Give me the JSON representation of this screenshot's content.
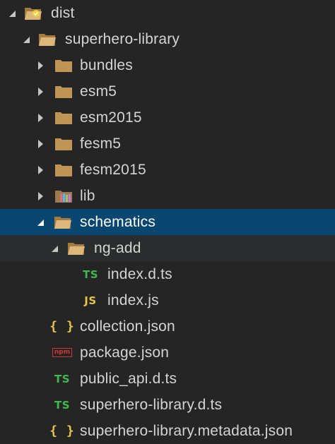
{
  "explorer": {
    "colors": {
      "background": "#252526",
      "selection": "#094771",
      "hover": "#2a2d2e",
      "folder": "#c09553",
      "ts": "#3fb950",
      "js": "#e8c547",
      "npm": "#cb3837"
    },
    "items": [
      {
        "label": "dist",
        "kind": "folder-open",
        "icon": "folder-open-icon",
        "expanded": true
      },
      {
        "label": "superhero-library",
        "kind": "folder-open",
        "icon": "folder-open-icon",
        "expanded": true
      },
      {
        "label": "bundles",
        "kind": "folder",
        "icon": "folder-icon",
        "expanded": false
      },
      {
        "label": "esm5",
        "kind": "folder",
        "icon": "folder-icon",
        "expanded": false
      },
      {
        "label": "esm2015",
        "kind": "folder",
        "icon": "folder-icon",
        "expanded": false
      },
      {
        "label": "fesm5",
        "kind": "folder",
        "icon": "folder-icon",
        "expanded": false
      },
      {
        "label": "fesm2015",
        "kind": "folder",
        "icon": "folder-icon",
        "expanded": false
      },
      {
        "label": "lib",
        "kind": "folder-lib",
        "icon": "lib-folder-icon",
        "expanded": false
      },
      {
        "label": "schematics",
        "kind": "folder-open",
        "icon": "folder-open-icon",
        "expanded": true,
        "selected": true
      },
      {
        "label": "ng-add",
        "kind": "folder-open",
        "icon": "folder-open-icon",
        "expanded": true,
        "hover": true
      },
      {
        "label": "index.d.ts",
        "kind": "ts",
        "icon": "typescript-icon",
        "badge": "TS"
      },
      {
        "label": "index.js",
        "kind": "js",
        "icon": "javascript-icon",
        "badge": "JS"
      },
      {
        "label": "collection.json",
        "kind": "json",
        "icon": "json-icon",
        "badge": "{ }"
      },
      {
        "label": "package.json",
        "kind": "npm",
        "icon": "npm-icon",
        "badge": "npm"
      },
      {
        "label": "public_api.d.ts",
        "kind": "ts",
        "icon": "typescript-icon",
        "badge": "TS"
      },
      {
        "label": "superhero-library.d.ts",
        "kind": "ts",
        "icon": "typescript-icon",
        "badge": "TS"
      },
      {
        "label": "superhero-library.metadata.json",
        "kind": "json",
        "icon": "json-icon",
        "badge": "{ }"
      }
    ]
  }
}
